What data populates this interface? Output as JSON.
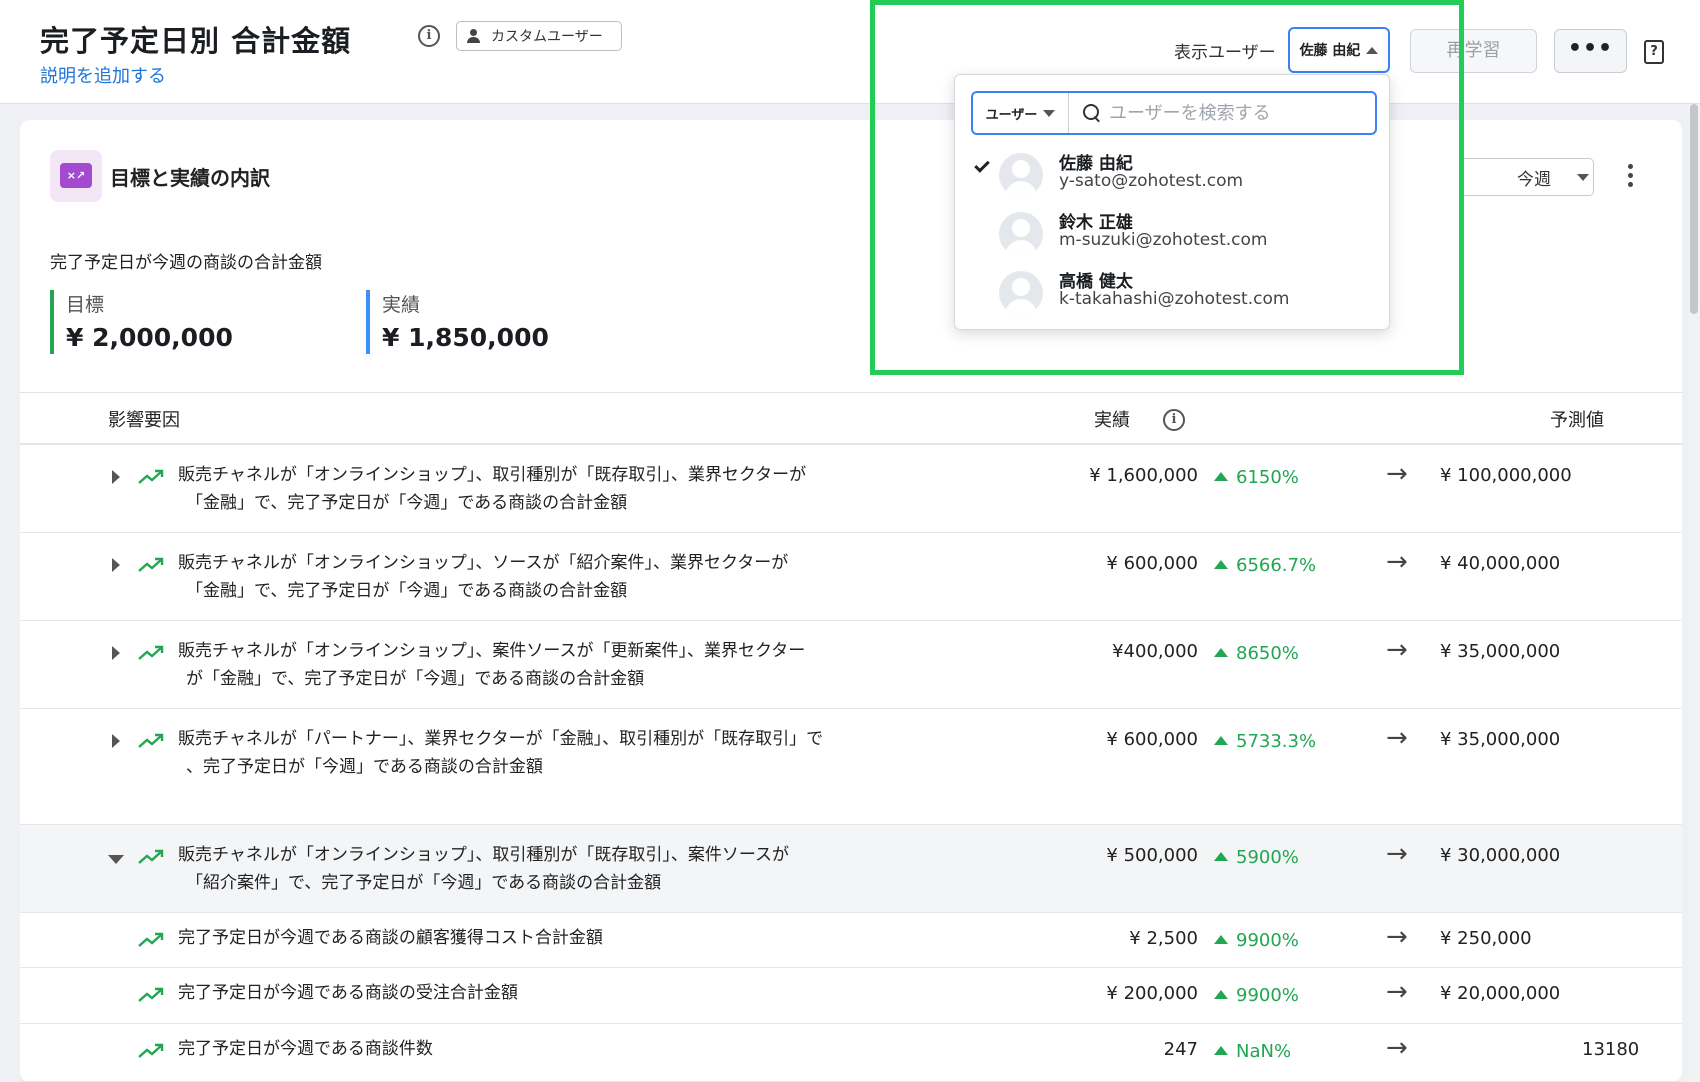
{
  "header": {
    "title": "完了予定日別 合計金額",
    "add_description": "説明を追加する",
    "info_icon": "i",
    "custom_user_label": "カスタムユーザー",
    "viewer_label": "表示ユーザー",
    "selected_user": "佐藤 由紀",
    "retrain_label": "再学習",
    "more_label": "•••",
    "help_icon": "?"
  },
  "panel": {
    "icon_text": "×↗",
    "title": "目標と実績の内訳",
    "period": "今週",
    "subtitle": "完了予定日が今週の商談の合計金額",
    "target_label": "目標",
    "target_value": "¥ 2,000,000",
    "actual_label": "実績",
    "actual_value": "¥ 1,850,000"
  },
  "table": {
    "col_factor": "影響要因",
    "col_actual": "実績",
    "col_forecast": "予測値",
    "rows": [
      {
        "text1": "販売チャネルが「オンラインショップ」、取引種別が「既存取引」、業界セクターが",
        "text2": "「金融」で、完了予定日が「今週」である商談の合計金額",
        "actual": "¥ 1,600,000",
        "growth": "6150%",
        "forecast": "¥ 100,000,000"
      },
      {
        "text1": "販売チャネルが「オンラインショップ」、ソースが「紹介案件」、業界セクターが",
        "text2": "「金融」で、完了予定日が「今週」である商談の合計金額",
        "actual": "¥ 600,000",
        "growth": "6566.7%",
        "forecast": "¥ 40,000,000"
      },
      {
        "text1": "販売チャネルが「オンラインショップ」、案件ソースが「更新案件」、業界セクター",
        "text2": "が「金融」で、完了予定日が「今週」である商談の合計金額",
        "actual": "¥400,000",
        "growth": "8650%",
        "forecast": "¥ 35,000,000"
      },
      {
        "text1": "販売チャネルが「パートナー」、業界セクターが「金融」、取引種別が「既存取引」で",
        "text2": "、完了予定日が「今週」である商談の合計金額",
        "actual": "¥ 600,000",
        "growth": "5733.3%",
        "forecast": "¥ 35,000,000"
      },
      {
        "text1": "販売チャネルが「オンラインショップ」、取引種別が「既存取引」、案件ソースが",
        "text2": "「紹介案件」で、完了予定日が「今週」である商談の合計金額",
        "actual": "¥ 500,000",
        "growth": "5900%",
        "forecast": "¥ 30,000,000"
      }
    ],
    "subrows": [
      {
        "text": "完了予定日が今週である商談の顧客獲得コスト合計金額",
        "actual": "¥ 2,500",
        "growth": "9900%",
        "forecast": "¥ 250,000"
      },
      {
        "text": "完了予定日が今週である商談の受注合計金額",
        "actual": "¥ 200,000",
        "growth": "9900%",
        "forecast": "¥ 20,000,000"
      },
      {
        "text": "完了予定日が今週である商談件数",
        "actual": "247",
        "growth": "NaN%",
        "forecast": "13180"
      }
    ],
    "arrow": "→"
  },
  "dropdown": {
    "filter_label": "ユーザー",
    "search_placeholder": "ユーザーを検索する",
    "users": [
      {
        "name": "佐藤 由紀",
        "email": "y-sato@zohotest.com",
        "selected": true
      },
      {
        "name": "鈴木 正雄",
        "email": "m-suzuki@zohotest.com",
        "selected": false
      },
      {
        "name": "高橋 健太",
        "email": "k-takahashi@zohotest.com",
        "selected": false
      }
    ]
  },
  "colors": {
    "accent": "#3b82f6",
    "growth_green": "#22a652",
    "highlight_green": "#22cc55",
    "target_bar": "#22a652",
    "actual_bar": "#3b8ff6"
  }
}
